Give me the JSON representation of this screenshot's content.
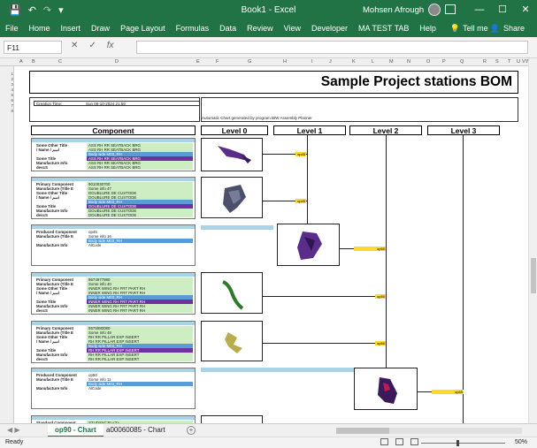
{
  "app": {
    "title": "Book1 - Excel",
    "user_name": "Mohsen Afrough"
  },
  "menu": {
    "tabs": [
      "File",
      "Home",
      "Insert",
      "Draw",
      "Page Layout",
      "Formulas",
      "Data",
      "Review",
      "View",
      "Developer",
      "MA TEST TAB",
      "Help"
    ],
    "tell_me": "Tell me",
    "share": "Share"
  },
  "formula": {
    "name_box": "F11",
    "cancel": "✕",
    "enter": "✓",
    "fx": "fx",
    "value": ""
  },
  "columns": [
    "A",
    "B",
    "C",
    "D",
    "E",
    "F",
    "G",
    "H",
    "I",
    "J",
    "K",
    "L",
    "M",
    "N",
    "O",
    "P",
    "Q",
    "R",
    "S",
    "T",
    "U",
    "V",
    "W"
  ],
  "rows_top": [
    "1",
    "2",
    "3",
    "4",
    "5",
    "6",
    "7",
    "8"
  ],
  "sheet": {
    "title": "Sample Project stations BOM",
    "creation_label": "Creation Time:",
    "creation_value": "Sun 06-10-2024 21:59",
    "auto_chart": "Automatic Chart generated by program BIW Assembly Planner",
    "headers": {
      "component": "Component",
      "level0": "Level 0",
      "level1": "Level 1",
      "level2": "Level 2",
      "level3": "Level 3"
    },
    "blocks": [
      {
        "lines": [
          {
            "k": "Some Other Title",
            "v": "ASS RH RR SEATBACK BRG",
            "c": "g"
          },
          {
            "k": "/ Name / اسم",
            "v": "ASS RH RR SEATBACK BRG",
            "c": "g"
          },
          {
            "k": "",
            "v": "Body side M03_RH",
            "c": "b"
          },
          {
            "k": "Some Title",
            "v": "ASS RH RR SEATBACK BRG",
            "c": "p"
          },
          {
            "k": "Manufacture Info",
            "v": "ASS RH RR SEATBACK BRG",
            "c": "g"
          },
          {
            "k": "descS",
            "v": "ASS RH RR SEATBACK BRG",
            "c": "g"
          }
        ]
      },
      {
        "lines": [
          {
            "k": "Primary Component",
            "v": "9010030700",
            "c": "g"
          },
          {
            "k": "Manufacture (Title E",
            "v": "Some info 47",
            "c": "g"
          },
          {
            "k": "Some Other Title",
            "v": "DOUBLURE DE CUSTODE",
            "c": "g"
          },
          {
            "k": "/ Name / اسم",
            "v": "DOUBLURE DE CUSTODE",
            "c": "g"
          },
          {
            "k": "",
            "v": "Body side M03_RH",
            "c": "b"
          },
          {
            "k": "Some Title",
            "v": "DOUBLURE DE CUSTODE",
            "c": "p"
          },
          {
            "k": "Manufacture Info",
            "v": "DOUBLURE DE CUSTODE",
            "c": "g"
          },
          {
            "k": "descS",
            "v": "DOUBLURE DE CUSTODE",
            "c": "g"
          }
        ]
      },
      {
        "lines": [
          {
            "k": "Produced Component",
            "v": "op45",
            "c": ""
          },
          {
            "k": "Manufacture (Title E",
            "v": "Some info 16",
            "c": ""
          },
          {
            "k": "",
            "v": "Body side M03_RH",
            "c": "b"
          },
          {
            "k": "Manufacture Info",
            "v": "AlCode",
            "c": ""
          }
        ]
      },
      {
        "lines": [
          {
            "k": "Primary Component",
            "v": "9674977980",
            "c": "g"
          },
          {
            "k": "Manufacture (Title E",
            "v": "Some info 40",
            "c": "g"
          },
          {
            "k": "Some Other Title",
            "v": "INNER WING RH FRT PART RH",
            "c": "g"
          },
          {
            "k": "/ Name / اسم",
            "v": "INNER WING RH FRT PART RH",
            "c": "g"
          },
          {
            "k": "",
            "v": "Body side M03_RH",
            "c": "b"
          },
          {
            "k": "Some Title",
            "v": "INNER WING RH FRT PART RH",
            "c": "p"
          },
          {
            "k": "Manufacture Info",
            "v": "INNER WING RH FRT PART RH",
            "c": "g"
          },
          {
            "k": "descS",
            "v": "INNER WING RH FRT PART RH",
            "c": "g"
          }
        ]
      },
      {
        "lines": [
          {
            "k": "Primary Component",
            "v": "9675080080",
            "c": "g"
          },
          {
            "k": "Manufacture (Title E",
            "v": "Some info 49",
            "c": "g"
          },
          {
            "k": "Some Other Title",
            "v": "RH RR PILLAR EXP INSERT",
            "c": "g"
          },
          {
            "k": "/ Name / اسم",
            "v": "RH RR PILLAR EXP INSERT",
            "c": "g"
          },
          {
            "k": "",
            "v": "Body side M03_RH",
            "c": "b"
          },
          {
            "k": "Some Title",
            "v": "RH RR PILLAR EXP INSERT",
            "c": "p"
          },
          {
            "k": "Manufacture Info",
            "v": "RH RR PILLAR EXP INSERT",
            "c": "g"
          },
          {
            "k": "descS",
            "v": "RH RR PILLAR EXP INSERT",
            "c": "g"
          }
        ]
      },
      {
        "lines": [
          {
            "k": "Produced Component",
            "v": "op50",
            "c": ""
          },
          {
            "k": "Manufacture (Title E",
            "v": "Some info 11",
            "c": ""
          },
          {
            "k": "",
            "v": "Body side M03_RH",
            "c": "b"
          },
          {
            "k": "Manufacture Info",
            "v": "AlCode",
            "c": ""
          }
        ]
      },
      {
        "lines": [
          {
            "k": "Standard Component",
            "v": "STUDSXC30 <3>",
            "c": "g"
          },
          {
            "k": "Manufacture (Title E",
            "v": "Some info 12",
            "c": "g"
          }
        ]
      }
    ],
    "op_tags": [
      "op45",
      "op45",
      "op50",
      "op50",
      "op50",
      "op55"
    ]
  },
  "tabs": {
    "sheets": [
      "op90 - Chart",
      "a00060085 - Chart"
    ],
    "add": "+"
  },
  "status": {
    "ready": "Ready",
    "zoom": "50%"
  }
}
